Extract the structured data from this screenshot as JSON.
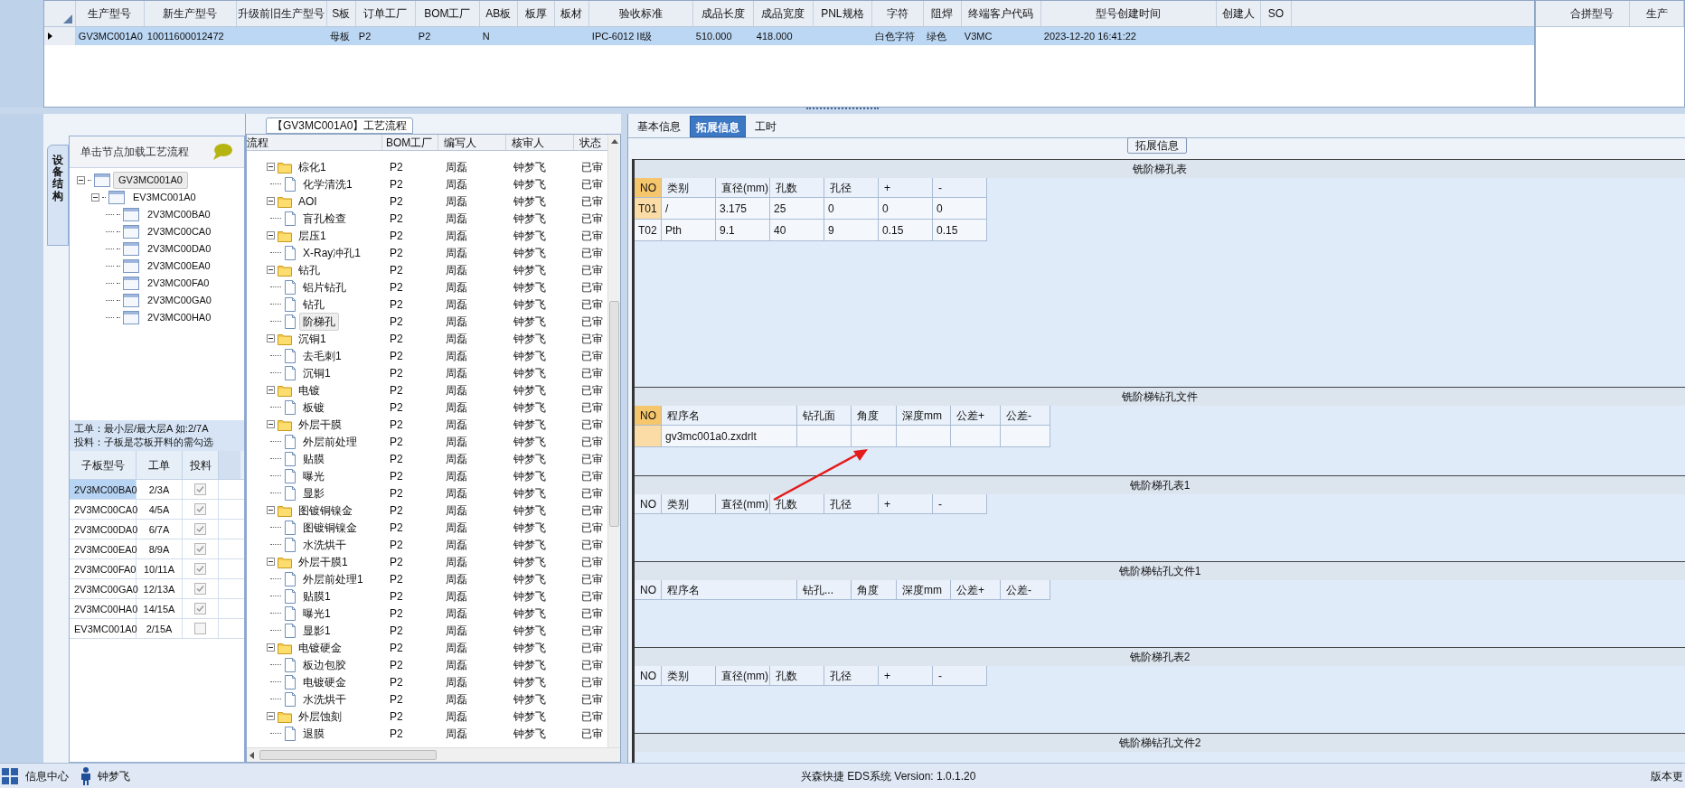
{
  "main_grid": {
    "columns": [
      "生产型号",
      "新生产型号",
      "升级前旧生产型号",
      "S板",
      "订单工厂",
      "BOM工厂",
      "AB板",
      "板厚",
      "板材",
      "验收标准",
      "成品长度",
      "成品宽度",
      "PNL规格",
      "字符",
      "阻焊",
      "终端客户代码",
      "型号创建时间",
      "创建人",
      "SO"
    ],
    "rows": [
      {
        "selected": true,
        "cells": [
          "GV3MC001A0",
          "10011600012472",
          "",
          "母板",
          "P2",
          "P2",
          "N",
          "",
          "",
          "IPC-6012 II级",
          "510.000",
          "418.000",
          "",
          "白色字符",
          "绿色",
          "V3MC",
          "2023-12-20 16:41:22",
          "",
          ""
        ]
      }
    ]
  },
  "merge_grid": {
    "columns": [
      "合拼型号",
      "生产"
    ]
  },
  "structure_panel": {
    "tab_label": "设备结构",
    "header": "单击节点加载工艺流程",
    "tree": [
      {
        "label": "GV3MC001A0",
        "selected": true,
        "expanded": true,
        "children": [
          {
            "label": "EV3MC001A0",
            "selected": false,
            "expanded": true,
            "children": [
              {
                "label": "2V3MC00BA0",
                "selected": false
              },
              {
                "label": "2V3MC00CA0",
                "selected": false
              },
              {
                "label": "2V3MC00DA0",
                "selected": false
              },
              {
                "label": "2V3MC00EA0",
                "selected": false
              },
              {
                "label": "2V3MC00FA0",
                "selected": false
              },
              {
                "label": "2V3MC00GA0",
                "selected": false
              },
              {
                "label": "2V3MC00HA0",
                "selected": false
              }
            ]
          }
        ]
      }
    ],
    "notes": [
      "工单：最小层/最大层A 如:2/7A",
      "投料：子板是芯板开料的需勾选"
    ],
    "board_grid": {
      "columns": [
        "子板型号",
        "工单",
        "投料"
      ],
      "rows": [
        {
          "selected": true,
          "cells": [
            "2V3MC00BA0",
            "2/3A"
          ],
          "checked": true
        },
        {
          "selected": false,
          "cells": [
            "2V3MC00CA0",
            "4/5A"
          ],
          "checked": true
        },
        {
          "selected": false,
          "cells": [
            "2V3MC00DA0",
            "6/7A"
          ],
          "checked": true
        },
        {
          "selected": false,
          "cells": [
            "2V3MC00EA0",
            "8/9A"
          ],
          "checked": true
        },
        {
          "selected": false,
          "cells": [
            "2V3MC00FA0",
            "10/11A"
          ],
          "checked": true
        },
        {
          "selected": false,
          "cells": [
            "2V3MC00GA0",
            "12/13A"
          ],
          "checked": true
        },
        {
          "selected": false,
          "cells": [
            "2V3MC00HA0",
            "14/15A"
          ],
          "checked": true
        },
        {
          "selected": false,
          "cells": [
            "EV3MC001A0",
            "2/15A"
          ],
          "checked": false
        }
      ]
    }
  },
  "process_panel": {
    "title": "【GV3MC001A0】工艺流程",
    "columns": [
      "流程",
      "BOM工厂",
      "编写人",
      "核审人",
      "状态"
    ],
    "steps": [
      {
        "label": "棕化1",
        "expanded": true,
        "selected": false,
        "cells": [
          "P2",
          "周磊",
          "钟梦飞",
          "已审"
        ],
        "children": [
          {
            "label": "化学清洗1",
            "selected": false,
            "cells": [
              "P2",
              "周磊",
              "钟梦飞",
              "已审"
            ]
          }
        ]
      },
      {
        "label": "AOI",
        "expanded": true,
        "selected": false,
        "cells": [
          "P2",
          "周磊",
          "钟梦飞",
          "已审"
        ],
        "children": [
          {
            "label": "盲孔检查",
            "selected": false,
            "cells": [
              "P2",
              "周磊",
              "钟梦飞",
              "已审"
            ]
          }
        ]
      },
      {
        "label": "层压1",
        "expanded": true,
        "selected": false,
        "cells": [
          "P2",
          "周磊",
          "钟梦飞",
          "已审"
        ],
        "children": [
          {
            "label": "X-Ray冲孔1",
            "selected": false,
            "cells": [
              "P2",
              "周磊",
              "钟梦飞",
              "已审"
            ]
          }
        ]
      },
      {
        "label": "钻孔",
        "expanded": true,
        "selected": false,
        "cells": [
          "P2",
          "周磊",
          "钟梦飞",
          "已审"
        ],
        "children": [
          {
            "label": "铝片钻孔",
            "selected": false,
            "cells": [
              "P2",
              "周磊",
              "钟梦飞",
              "已审"
            ]
          },
          {
            "label": "钻孔",
            "selected": false,
            "cells": [
              "P2",
              "周磊",
              "钟梦飞",
              "已审"
            ]
          },
          {
            "label": "阶梯孔",
            "selected": true,
            "cells": [
              "P2",
              "周磊",
              "钟梦飞",
              "已审"
            ]
          }
        ]
      },
      {
        "label": "沉铜1",
        "expanded": true,
        "selected": false,
        "cells": [
          "P2",
          "周磊",
          "钟梦飞",
          "已审"
        ],
        "children": [
          {
            "label": "去毛刺1",
            "selected": false,
            "cells": [
              "P2",
              "周磊",
              "钟梦飞",
              "已审"
            ]
          },
          {
            "label": "沉铜1",
            "selected": false,
            "cells": [
              "P2",
              "周磊",
              "钟梦飞",
              "已审"
            ]
          }
        ]
      },
      {
        "label": "电镀",
        "expanded": true,
        "selected": false,
        "cells": [
          "P2",
          "周磊",
          "钟梦飞",
          "已审"
        ],
        "children": [
          {
            "label": "板镀",
            "selected": false,
            "cells": [
              "P2",
              "周磊",
              "钟梦飞",
              "已审"
            ]
          }
        ]
      },
      {
        "label": "外层干膜",
        "expanded": true,
        "selected": false,
        "cells": [
          "P2",
          "周磊",
          "钟梦飞",
          "已审"
        ],
        "children": [
          {
            "label": "外层前处理",
            "selected": false,
            "cells": [
              "P2",
              "周磊",
              "钟梦飞",
              "已审"
            ]
          },
          {
            "label": "贴膜",
            "selected": false,
            "cells": [
              "P2",
              "周磊",
              "钟梦飞",
              "已审"
            ]
          },
          {
            "label": "曝光",
            "selected": false,
            "cells": [
              "P2",
              "周磊",
              "钟梦飞",
              "已审"
            ]
          },
          {
            "label": "显影",
            "selected": false,
            "cells": [
              "P2",
              "周磊",
              "钟梦飞",
              "已审"
            ]
          }
        ]
      },
      {
        "label": "图镀铜镍金",
        "expanded": true,
        "selected": false,
        "cells": [
          "P2",
          "周磊",
          "钟梦飞",
          "已审"
        ],
        "children": [
          {
            "label": "图镀铜镍金",
            "selected": false,
            "cells": [
              "P2",
              "周磊",
              "钟梦飞",
              "已审"
            ]
          },
          {
            "label": "水洗烘干",
            "selected": false,
            "cells": [
              "P2",
              "周磊",
              "钟梦飞",
              "已审"
            ]
          }
        ]
      },
      {
        "label": "外层干膜1",
        "expanded": true,
        "selected": false,
        "cells": [
          "P2",
          "周磊",
          "钟梦飞",
          "已审"
        ],
        "children": [
          {
            "label": "外层前处理1",
            "selected": false,
            "cells": [
              "P2",
              "周磊",
              "钟梦飞",
              "已审"
            ]
          },
          {
            "label": "贴膜1",
            "selected": false,
            "cells": [
              "P2",
              "周磊",
              "钟梦飞",
              "已审"
            ]
          },
          {
            "label": "曝光1",
            "selected": false,
            "cells": [
              "P2",
              "周磊",
              "钟梦飞",
              "已审"
            ]
          },
          {
            "label": "显影1",
            "selected": false,
            "cells": [
              "P2",
              "周磊",
              "钟梦飞",
              "已审"
            ]
          }
        ]
      },
      {
        "label": "电镀硬金",
        "expanded": true,
        "selected": false,
        "cells": [
          "P2",
          "周磊",
          "钟梦飞",
          "已审"
        ],
        "children": [
          {
            "label": "板边包胶",
            "selected": false,
            "cells": [
              "P2",
              "周磊",
              "钟梦飞",
              "已审"
            ]
          },
          {
            "label": "电镀硬金",
            "selected": false,
            "cells": [
              "P2",
              "周磊",
              "钟梦飞",
              "已审"
            ]
          },
          {
            "label": "水洗烘干",
            "selected": false,
            "cells": [
              "P2",
              "周磊",
              "钟梦飞",
              "已审"
            ]
          }
        ]
      },
      {
        "label": "外层蚀刻",
        "expanded": true,
        "selected": false,
        "cells": [
          "P2",
          "周磊",
          "钟梦飞",
          "已审"
        ],
        "children": [
          {
            "label": "退膜",
            "selected": false,
            "cells": [
              "P2",
              "周磊",
              "钟梦飞",
              "已审"
            ]
          }
        ]
      }
    ]
  },
  "detail_panel": {
    "tabs": [
      {
        "label": "基本信息",
        "selected": false
      },
      {
        "label": "拓展信息",
        "selected": true
      },
      {
        "label": "工时",
        "selected": false
      }
    ],
    "group_title": "拓展信息",
    "sections": [
      {
        "kind": "holes",
        "title": "铣阶梯孔表",
        "columns": [
          "NO",
          "类别",
          "直径(mm)",
          "孔数",
          "孔径",
          "+",
          "-"
        ],
        "rows": [
          {
            "selected": true,
            "cells": [
              "T01",
              "/",
              "3.175",
              "25",
              "0",
              "0",
              "0"
            ]
          },
          {
            "selected": false,
            "cells": [
              "T02",
              "Pth",
              "9.1",
              "40",
              "9",
              "0.15",
              "0.15"
            ]
          }
        ]
      },
      {
        "kind": "files",
        "title": "铣阶梯钻孔文件",
        "columns": [
          "NO",
          "程序名",
          "钻孔面",
          "角度",
          "深度mm",
          "公差+",
          "公差-"
        ],
        "rows": [
          {
            "selected": true,
            "cells": [
              "",
              "gv3mc001a0.zxdrlt",
              "",
              "",
              "",
              "",
              ""
            ]
          }
        ]
      },
      {
        "kind": "holes",
        "title": "铣阶梯孔表1",
        "columns": [
          "NO",
          "类别",
          "直径(mm)",
          "孔数",
          "孔径",
          "+",
          "-"
        ]
      },
      {
        "kind": "files",
        "title": "铣阶梯钻孔文件1",
        "columns": [
          "NO",
          "程序名",
          "钻孔...",
          "角度",
          "深度mm",
          "公差+",
          "公差-"
        ]
      },
      {
        "kind": "holes",
        "title": "铣阶梯孔表2",
        "columns": [
          "NO",
          "类别",
          "直径(mm)",
          "孔数",
          "孔径",
          "+",
          "-"
        ]
      },
      {
        "kind": "files",
        "title": "铣阶梯钻孔文件2"
      }
    ]
  },
  "status_bar": {
    "module": "信息中心",
    "user": "钟梦飞",
    "version": "兴森快捷 EDS系统 Version: 1.0.1.20",
    "right": "版本更"
  }
}
